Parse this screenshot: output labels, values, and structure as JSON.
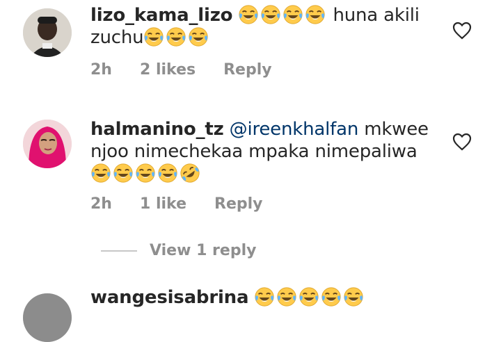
{
  "comments": [
    {
      "username": "lizo_kama_lizo",
      "text_before": "",
      "mention": "",
      "text": "huna akili zuchu",
      "time": "2h",
      "likes": "2 likes",
      "reply_label": "Reply"
    },
    {
      "username": "halmanino_tz",
      "mention": "@ireenkhalfan",
      "text": "mkwee njoo nimechekaa mpaka nimepaliwa",
      "time": "2h",
      "likes": "1 like",
      "reply_label": "Reply"
    },
    {
      "username": "wangesisabrina"
    }
  ],
  "view_replies_label": "View 1 reply",
  "icons": {
    "heart": "heart-outline-icon",
    "laugh": "face-with-tears-of-joy-emoji",
    "rofl": "rolling-on-floor-laughing-emoji"
  },
  "colors": {
    "text": "#262626",
    "secondary": "#8e8e8e",
    "mention": "#003569",
    "emoji_yellow": "#ffcb4c",
    "emoji_tear": "#5db5ff"
  }
}
